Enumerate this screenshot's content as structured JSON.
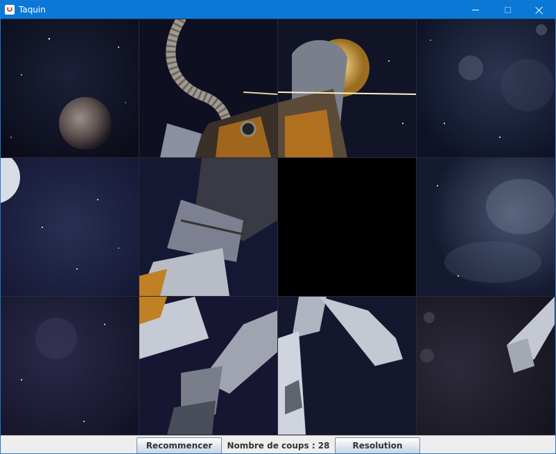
{
  "window": {
    "title": "Taquin",
    "icon": "java-cup-icon",
    "controls": [
      "minimize-icon",
      "maximize-icon",
      "close-icon"
    ]
  },
  "board": {
    "rows": 3,
    "cols": 4,
    "empty_tile": {
      "row": 1,
      "col": 2
    },
    "tiles": [
      [
        "planet",
        "astronaut-helmet-tube",
        "astronaut-helmet",
        "nebula"
      ],
      [
        "moon-edge",
        "astronaut-torso",
        "empty",
        "nebula-cloud"
      ],
      [
        "starfield",
        "astronaut-leg",
        "astronaut-legs",
        "astronaut-boot"
      ]
    ]
  },
  "footer": {
    "restart_label": "Recommencer",
    "moves_text": "Nombre de coups : 28",
    "solve_label": "Resolution"
  },
  "colors": {
    "titlebar": "#0a78d7",
    "empty_tile": "#000000",
    "space": "#0d0f1f"
  }
}
